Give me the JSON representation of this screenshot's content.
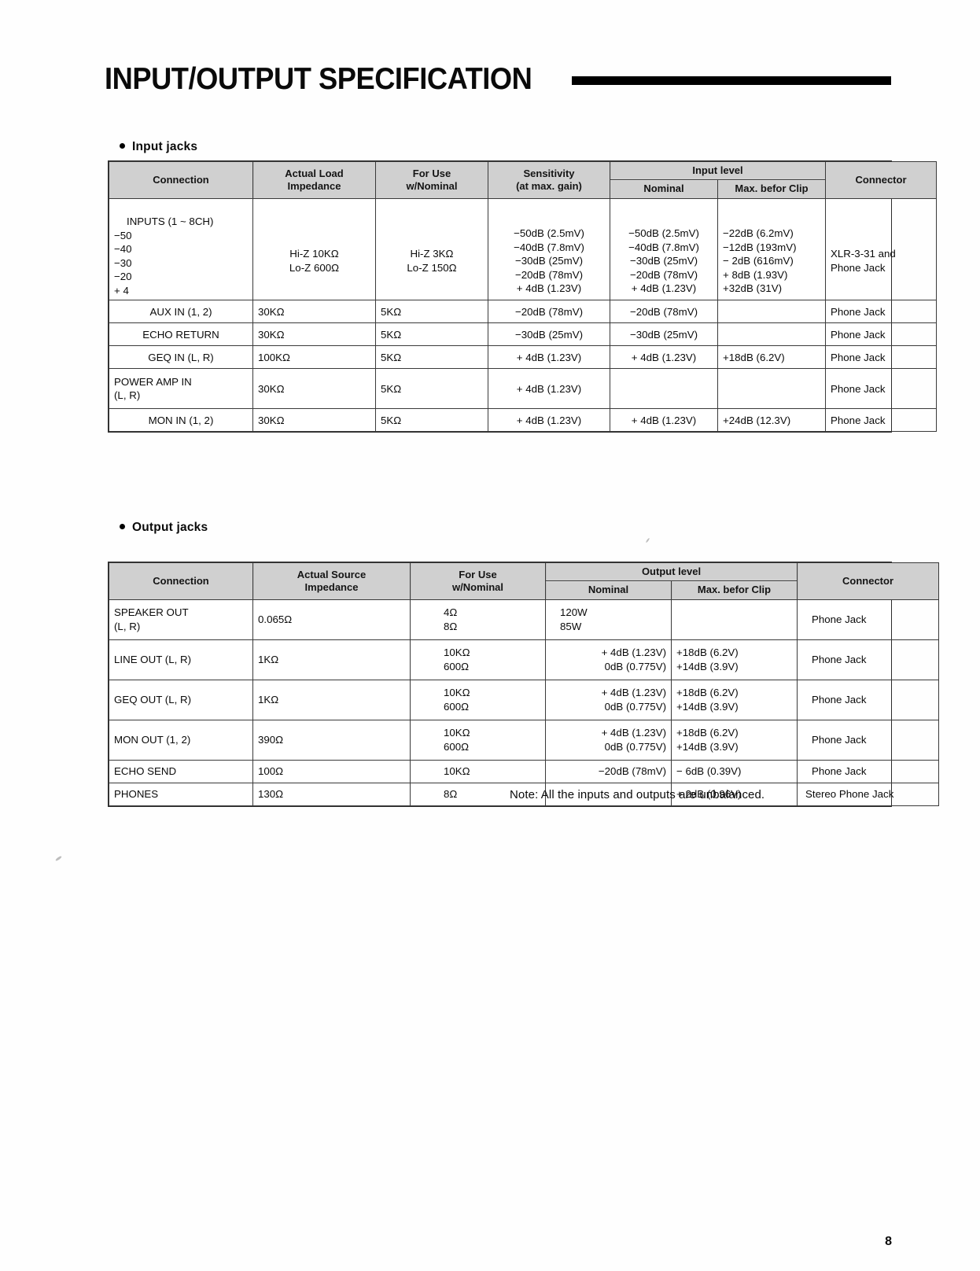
{
  "document": {
    "title": "INPUT/OUTPUT SPECIFICATION",
    "page_number": "8",
    "note": "Note: All the inputs and outputs are unbalanced."
  },
  "input_jacks": {
    "heading": "Input jacks",
    "columns": {
      "connection": "Connection",
      "impedance_line1": "Actual Load",
      "impedance_line2": "Impedance",
      "foruse_line1": "For Use",
      "foruse_line2": "w/Nominal",
      "sensitivity_line1": "Sensitivity",
      "sensitivity_line2": "(at max. gain)",
      "level_group": "Input level",
      "level_nominal": "Nominal",
      "level_max": "Max. befor Clip",
      "connector": "Connector"
    },
    "rows": [
      {
        "connection_head": "INPUTS (1 ~ 8CH)",
        "connection_levels": "−50\n−40\n−30\n−20\n+ 4",
        "impedance": "Hi-Z 10KΩ\nLo-Z 600Ω",
        "for_use": "Hi-Z 3KΩ\nLo-Z 150Ω",
        "sensitivity": "−50dB (2.5mV)\n−40dB (7.8mV)\n−30dB (25mV)\n−20dB (78mV)\n+ 4dB (1.23V)",
        "nominal": "−50dB (2.5mV)\n−40dB (7.8mV)\n−30dB (25mV)\n−20dB (78mV)\n+ 4dB (1.23V)",
        "max_clip": "−22dB (6.2mV)\n−12dB (193mV)\n−  2dB (616mV)\n+  8dB (1.93V)\n+32dB (31V)",
        "connector": "XLR-3-31 and\nPhone Jack"
      },
      {
        "connection": "AUX IN (1, 2)",
        "impedance": "30KΩ",
        "for_use": "5KΩ",
        "sensitivity": "−20dB (78mV)",
        "nominal": "−20dB (78mV)",
        "max_clip": "",
        "connector": "Phone Jack"
      },
      {
        "connection": "ECHO RETURN",
        "impedance": "30KΩ",
        "for_use": "5KΩ",
        "sensitivity": "−30dB (25mV)",
        "nominal": "−30dB (25mV)",
        "max_clip": "",
        "connector": "Phone Jack"
      },
      {
        "connection": "GEQ IN (L, R)",
        "impedance": "100KΩ",
        "for_use": "5KΩ",
        "sensitivity": "+ 4dB (1.23V)",
        "nominal": "+ 4dB (1.23V)",
        "max_clip": "+18dB (6.2V)",
        "connector": "Phone Jack"
      },
      {
        "connection": "POWER AMP IN\n(L, R)",
        "impedance": "30KΩ",
        "for_use": "5KΩ",
        "sensitivity": "+ 4dB (1.23V)",
        "nominal": "",
        "max_clip": "",
        "connector": "Phone Jack"
      },
      {
        "connection": "MON IN (1, 2)",
        "impedance": "30KΩ",
        "for_use": "5KΩ",
        "sensitivity": "+ 4dB (1.23V)",
        "nominal": "+ 4dB (1.23V)",
        "max_clip": "+24dB (12.3V)",
        "connector": "Phone Jack"
      }
    ]
  },
  "output_jacks": {
    "heading": "Output jacks",
    "columns": {
      "connection": "Connection",
      "impedance_line1": "Actual Source",
      "impedance_line2": "Impedance",
      "foruse_line1": "For Use",
      "foruse_line2": "w/Nominal",
      "level_group": "Output level",
      "level_nominal": "Nominal",
      "level_max": "Max. befor Clip",
      "connector": "Connector"
    },
    "rows": [
      {
        "connection": "SPEAKER OUT\n(L, R)",
        "impedance": "0.065Ω",
        "for_use": "4Ω\n8Ω",
        "nominal": "120W\n85W",
        "max_clip": "",
        "connector": "Phone Jack"
      },
      {
        "connection": "LINE OUT (L, R)",
        "impedance": "1KΩ",
        "for_use": "10KΩ\n600Ω",
        "nominal": "+ 4dB (1.23V)\n0dB (0.775V)",
        "max_clip": "+18dB (6.2V)\n+14dB (3.9V)",
        "connector": "Phone Jack"
      },
      {
        "connection": "GEQ OUT (L, R)",
        "impedance": "1KΩ",
        "for_use": "10KΩ\n600Ω",
        "nominal": "+ 4dB (1.23V)\n0dB (0.775V)",
        "max_clip": "+18dB (6.2V)\n+14dB (3.9V)",
        "connector": "Phone Jack"
      },
      {
        "connection": "MON OUT (1, 2)",
        "impedance": "390Ω",
        "for_use": "10KΩ\n600Ω",
        "nominal": "+ 4dB (1.23V)\n0dB (0.775V)",
        "max_clip": "+18dB (6.2V)\n+14dB (3.9V)",
        "connector": "Phone Jack"
      },
      {
        "connection": "ECHO SEND",
        "impedance": "100Ω",
        "for_use": "10KΩ",
        "nominal": "−20dB (78mV)",
        "max_clip": "−  6dB (0.39V)",
        "connector": "Phone Jack"
      },
      {
        "connection": "PHONES",
        "impedance": "130Ω",
        "for_use": "8Ω",
        "nominal": "",
        "max_clip": "+  2dB (0.96V)",
        "connector": "Stereo Phone Jack"
      }
    ]
  }
}
